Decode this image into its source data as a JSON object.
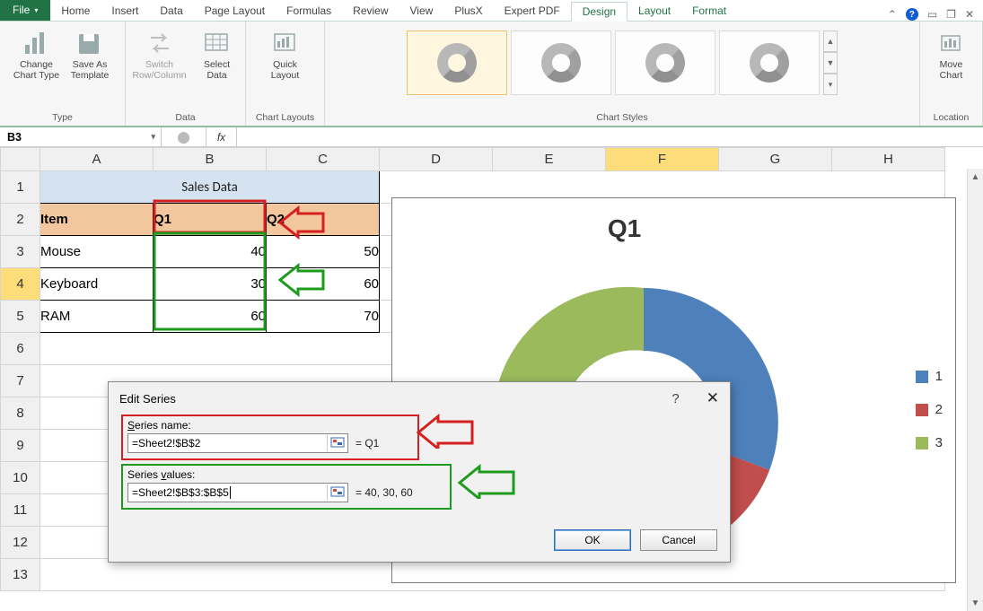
{
  "tabs": {
    "file": "File",
    "list": [
      "Home",
      "Insert",
      "Data",
      "Page Layout",
      "Formulas",
      "Review",
      "View",
      "PlusX",
      "Expert PDF",
      "Design",
      "Layout",
      "Format"
    ],
    "active": "Design"
  },
  "ribbon": {
    "type_group": "Type",
    "change_chart_type": "Change\nChart Type",
    "save_as_template": "Save As\nTemplate",
    "data_group": "Data",
    "switch_rc": "Switch\nRow/Column",
    "select_data": "Select\nData",
    "layouts_group": "Chart Layouts",
    "quick_layout": "Quick\nLayout",
    "styles_group": "Chart Styles",
    "location_group": "Location",
    "move_chart": "Move\nChart"
  },
  "namebox": "B3",
  "fx": "fx",
  "columns": [
    "A",
    "B",
    "C",
    "D",
    "E",
    "F",
    "G",
    "H"
  ],
  "rows": [
    "1",
    "2",
    "3",
    "4",
    "5",
    "6",
    "7",
    "8",
    "9",
    "10",
    "11",
    "12",
    "13"
  ],
  "selected_col": "F",
  "selected_row": "4",
  "table": {
    "title": "Sales Data",
    "headers": [
      "Item",
      "Q1",
      "Q2"
    ],
    "rows": [
      {
        "item": "Mouse",
        "q1": "40",
        "q2": "50"
      },
      {
        "item": "Keyboard",
        "q1": "30",
        "q2": "60"
      },
      {
        "item": "RAM",
        "q1": "60",
        "q2": "70"
      }
    ]
  },
  "chart_data": {
    "type": "pie",
    "title": "Q1",
    "series_name": "Q1",
    "categories": [
      "1",
      "2",
      "3"
    ],
    "values": [
      40,
      30,
      60
    ],
    "colors": [
      "#4e80bc",
      "#bf4e4c",
      "#9bba5c"
    ],
    "legend": [
      "1",
      "2",
      "3"
    ]
  },
  "dialog": {
    "title": "Edit Series",
    "name_label": "Series name:",
    "name_value": "=Sheet2!$B$2",
    "name_eq": "= Q1",
    "values_label": "Series values:",
    "values_value": "=Sheet2!$B$3:$B$5",
    "values_eq": "= 40, 30, 60",
    "ok": "OK",
    "cancel": "Cancel"
  }
}
